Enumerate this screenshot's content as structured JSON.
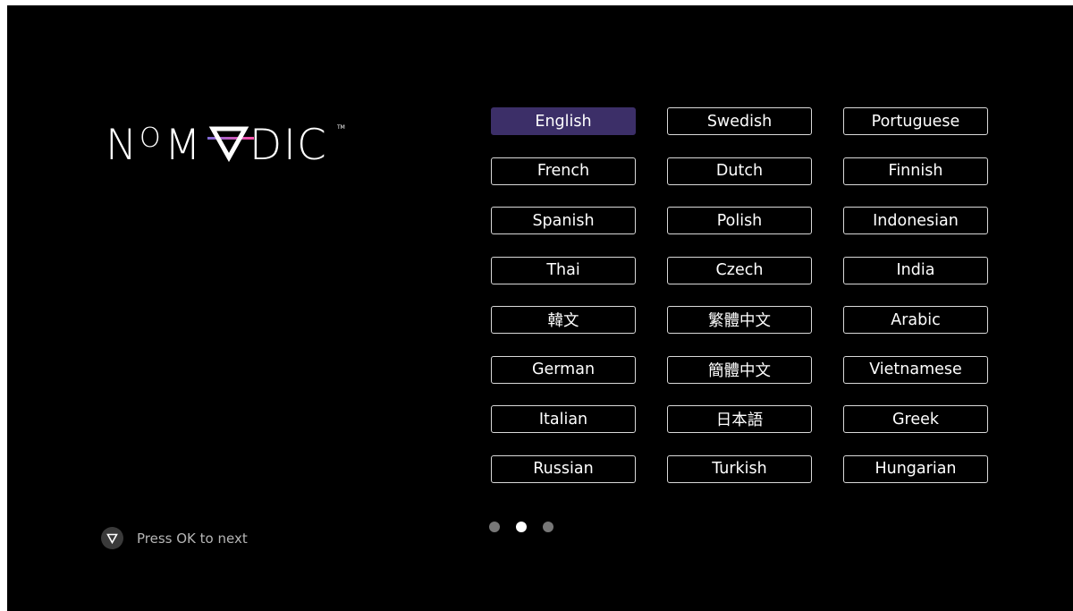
{
  "brand": {
    "logo_text": "NOMVDIC",
    "trademark": "TM",
    "colors": {
      "screen_background": "#000000",
      "selected_button": "#3c2f68",
      "logo_accent_start": "#7e6bd6",
      "logo_accent_end": "#ff4fa8"
    }
  },
  "languages": [
    {
      "label": "English",
      "selected": true
    },
    {
      "label": "Swedish",
      "selected": false
    },
    {
      "label": "Portuguese",
      "selected": false
    },
    {
      "label": "French",
      "selected": false
    },
    {
      "label": "Dutch",
      "selected": false
    },
    {
      "label": "Finnish",
      "selected": false
    },
    {
      "label": "Spanish",
      "selected": false
    },
    {
      "label": "Polish",
      "selected": false
    },
    {
      "label": "Indonesian",
      "selected": false
    },
    {
      "label": "Thai",
      "selected": false
    },
    {
      "label": "Czech",
      "selected": false
    },
    {
      "label": "India",
      "selected": false
    },
    {
      "label": "韓文",
      "selected": false
    },
    {
      "label": "繁體中文",
      "selected": false
    },
    {
      "label": "Arabic",
      "selected": false
    },
    {
      "label": "German",
      "selected": false
    },
    {
      "label": "簡體中文",
      "selected": false
    },
    {
      "label": "Vietnamese",
      "selected": false
    },
    {
      "label": "Italian",
      "selected": false
    },
    {
      "label": "日本語",
      "selected": false
    },
    {
      "label": "Greek",
      "selected": false
    },
    {
      "label": "Russian",
      "selected": false
    },
    {
      "label": "Turkish",
      "selected": false
    },
    {
      "label": "Hungarian",
      "selected": false
    }
  ],
  "pagination": {
    "total_pages": 3,
    "current_page": 2
  },
  "hint": {
    "icon": "down-triangle-icon",
    "text": "Press OK to next"
  }
}
